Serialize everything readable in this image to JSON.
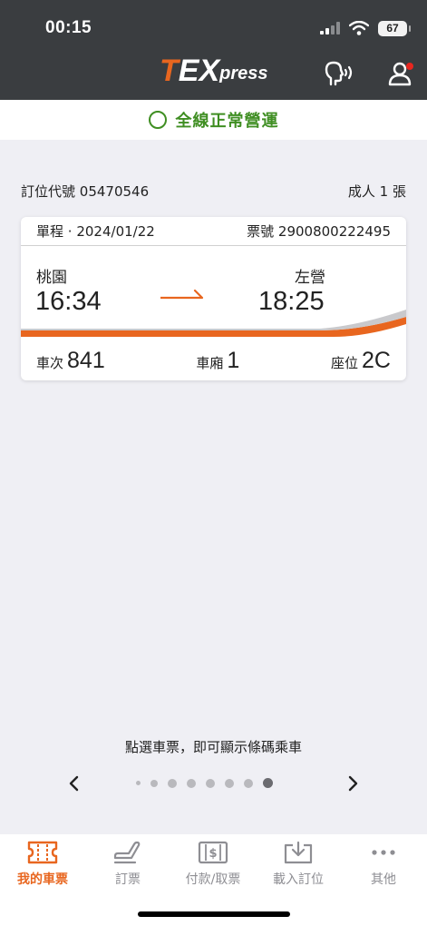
{
  "status_bar": {
    "time": "00:15",
    "battery": "67"
  },
  "header": {
    "brand_t": "T",
    "brand_ex": "EX",
    "brand_press": "press"
  },
  "service": {
    "status": "全線正常營運"
  },
  "booking": {
    "code_label": "訂位代號",
    "code": "05470546",
    "passengers": "成人 1 張"
  },
  "ticket": {
    "trip_type": "單程",
    "date": "2024/01/22",
    "ticket_no_label": "票號",
    "ticket_no": "2900800222495",
    "from_station": "桃園",
    "to_station": "左營",
    "depart_time": "16:34",
    "arrive_time": "18:25",
    "train_label": "車次",
    "train_no": "841",
    "car_label": "車廂",
    "car_no": "1",
    "seat_label": "座位",
    "seat_no": "2C"
  },
  "hint": "點選車票，即可顯示條碼乘車",
  "pager": {
    "total_pages": 8,
    "current_page": 8
  },
  "tabs": [
    {
      "label": "我的車票",
      "icon": "ticket-icon",
      "active": true
    },
    {
      "label": "訂票",
      "icon": "seat-icon",
      "active": false
    },
    {
      "label": "付款/取票",
      "icon": "payment-icon",
      "active": false
    },
    {
      "label": "載入訂位",
      "icon": "import-icon",
      "active": false
    },
    {
      "label": "其他",
      "icon": "more-icon",
      "active": false
    }
  ],
  "colors": {
    "brand_orange": "#e8661f",
    "header_dark": "#3a3d40",
    "service_green": "#3f8e22",
    "notification_red": "#e8261f"
  }
}
